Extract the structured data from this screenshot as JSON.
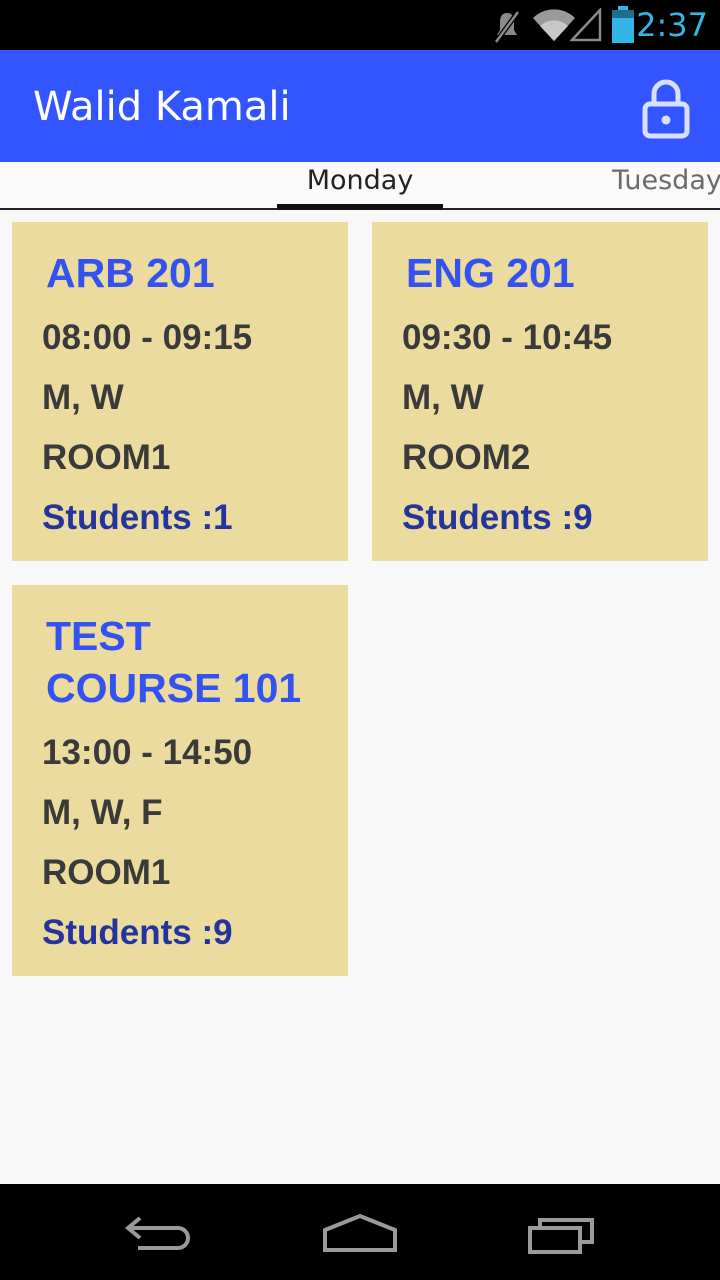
{
  "status_bar": {
    "time": "2:37",
    "icons": [
      "mute-icon",
      "wifi-icon",
      "signal-icon",
      "battery-icon"
    ],
    "color_time": "#33b5e5"
  },
  "app_bar": {
    "title": "Walid Kamali",
    "action_icon": "lock-icon",
    "color": "#3355ff"
  },
  "tabs": [
    {
      "label": "Monday",
      "selected": true
    },
    {
      "label": "Tuesday",
      "selected": false
    }
  ],
  "courses": [
    {
      "title": "ARB 201",
      "time": "08:00 - 09:15",
      "days": "M, W",
      "room": "ROOM1",
      "students": "Students :1"
    },
    {
      "title": "ENG 201",
      "time": "09:30 - 10:45",
      "days": "M, W",
      "room": "ROOM2",
      "students": "Students :9"
    },
    {
      "title": "TEST COURSE 101",
      "time": "13:00 - 14:50",
      "days": "M, W, F",
      "room": "ROOM1",
      "students": "Students :9"
    }
  ],
  "colors": {
    "card_background": "#ecdb9e",
    "course_title": "#3352f0",
    "students_text": "#23349c"
  },
  "nav_bar": {
    "buttons": [
      "back-icon",
      "home-icon",
      "recents-icon"
    ]
  }
}
